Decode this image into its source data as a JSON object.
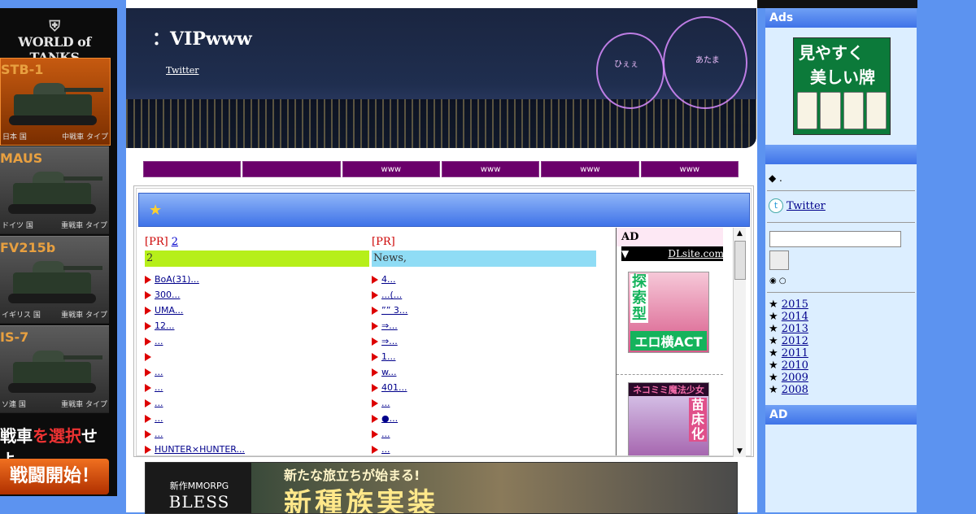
{
  "left_ad": {
    "logo": "WORLD of TANKS",
    "tanks": [
      {
        "name": "STB-1",
        "nation": "日本 国",
        "type": "中戦車 タイプ"
      },
      {
        "name": "MAUS",
        "nation": "ドイツ 国",
        "type": "重戦車 タイプ"
      },
      {
        "name": "FV215b",
        "nation": "イギリス 国",
        "type": "重戦車 タイプ"
      },
      {
        "name": "IS-7",
        "nation": "ソ連 国",
        "type": "重戦車 タイプ"
      }
    ],
    "tagline_prefix": "戦車",
    "tagline_red": "を選択",
    "tagline_suffix": "せよ。",
    "cta": "戦闘開始！"
  },
  "header": {
    "title": "：VIPwww",
    "twitter": "Twitter",
    "sketch_text_1": "ひぇぇ",
    "sketch_text_2": "あたま"
  },
  "nav": [
    "",
    "",
    "www",
    "www",
    "www",
    "www"
  ],
  "banner": {
    "star": "★"
  },
  "col1": {
    "pr": "[PR]",
    "pr_link": "2",
    "category": "2",
    "items": [
      "BoA(31)...",
      "300...",
      "UMA...",
      "12...",
      "...",
      "",
      "...",
      "...",
      "...",
      "...",
      "...",
      "HUNTER×HUNTER..."
    ]
  },
  "col2": {
    "pr": "[PR]",
    "pr_link": "",
    "category": "News,",
    "items": [
      "4...",
      "...(...",
      "”” 3...",
      "⇒...",
      "⇒...",
      "1...",
      "w...",
      "401...",
      "...",
      "●...",
      "...",
      "..."
    ]
  },
  "ad_col": {
    "head": "AD",
    "dl_arrow": "▼",
    "dl_link": "DLsite.com",
    "ad1_vertical": "探索型",
    "ad1_bottom": "エロ横ACT",
    "ad2_top": "ネコミミ魔法少女",
    "ad2_vertical": "苗床化"
  },
  "scrollbar": {
    "up": "▲",
    "down": "▼"
  },
  "bless_ad": {
    "sub": "新作MMORPG",
    "brand": "BLESS",
    "slogan": "新たな旅立ちが始まる!",
    "big": "新種族実装"
  },
  "sidebar": {
    "ads_head": "Ads",
    "mahjong_line1": "見やすく",
    "mahjong_line2": "美しい牌",
    "head2": "",
    "diamond": "◆ .",
    "twitter": "Twitter",
    "twitter_icon": "t",
    "radio_selected": "◉",
    "radio_unselected": "○",
    "years": [
      "2015",
      "2014",
      "2013",
      "2012",
      "2011",
      "2010",
      "2009",
      "2008"
    ],
    "year_star": "★",
    "ad_head": "AD"
  }
}
